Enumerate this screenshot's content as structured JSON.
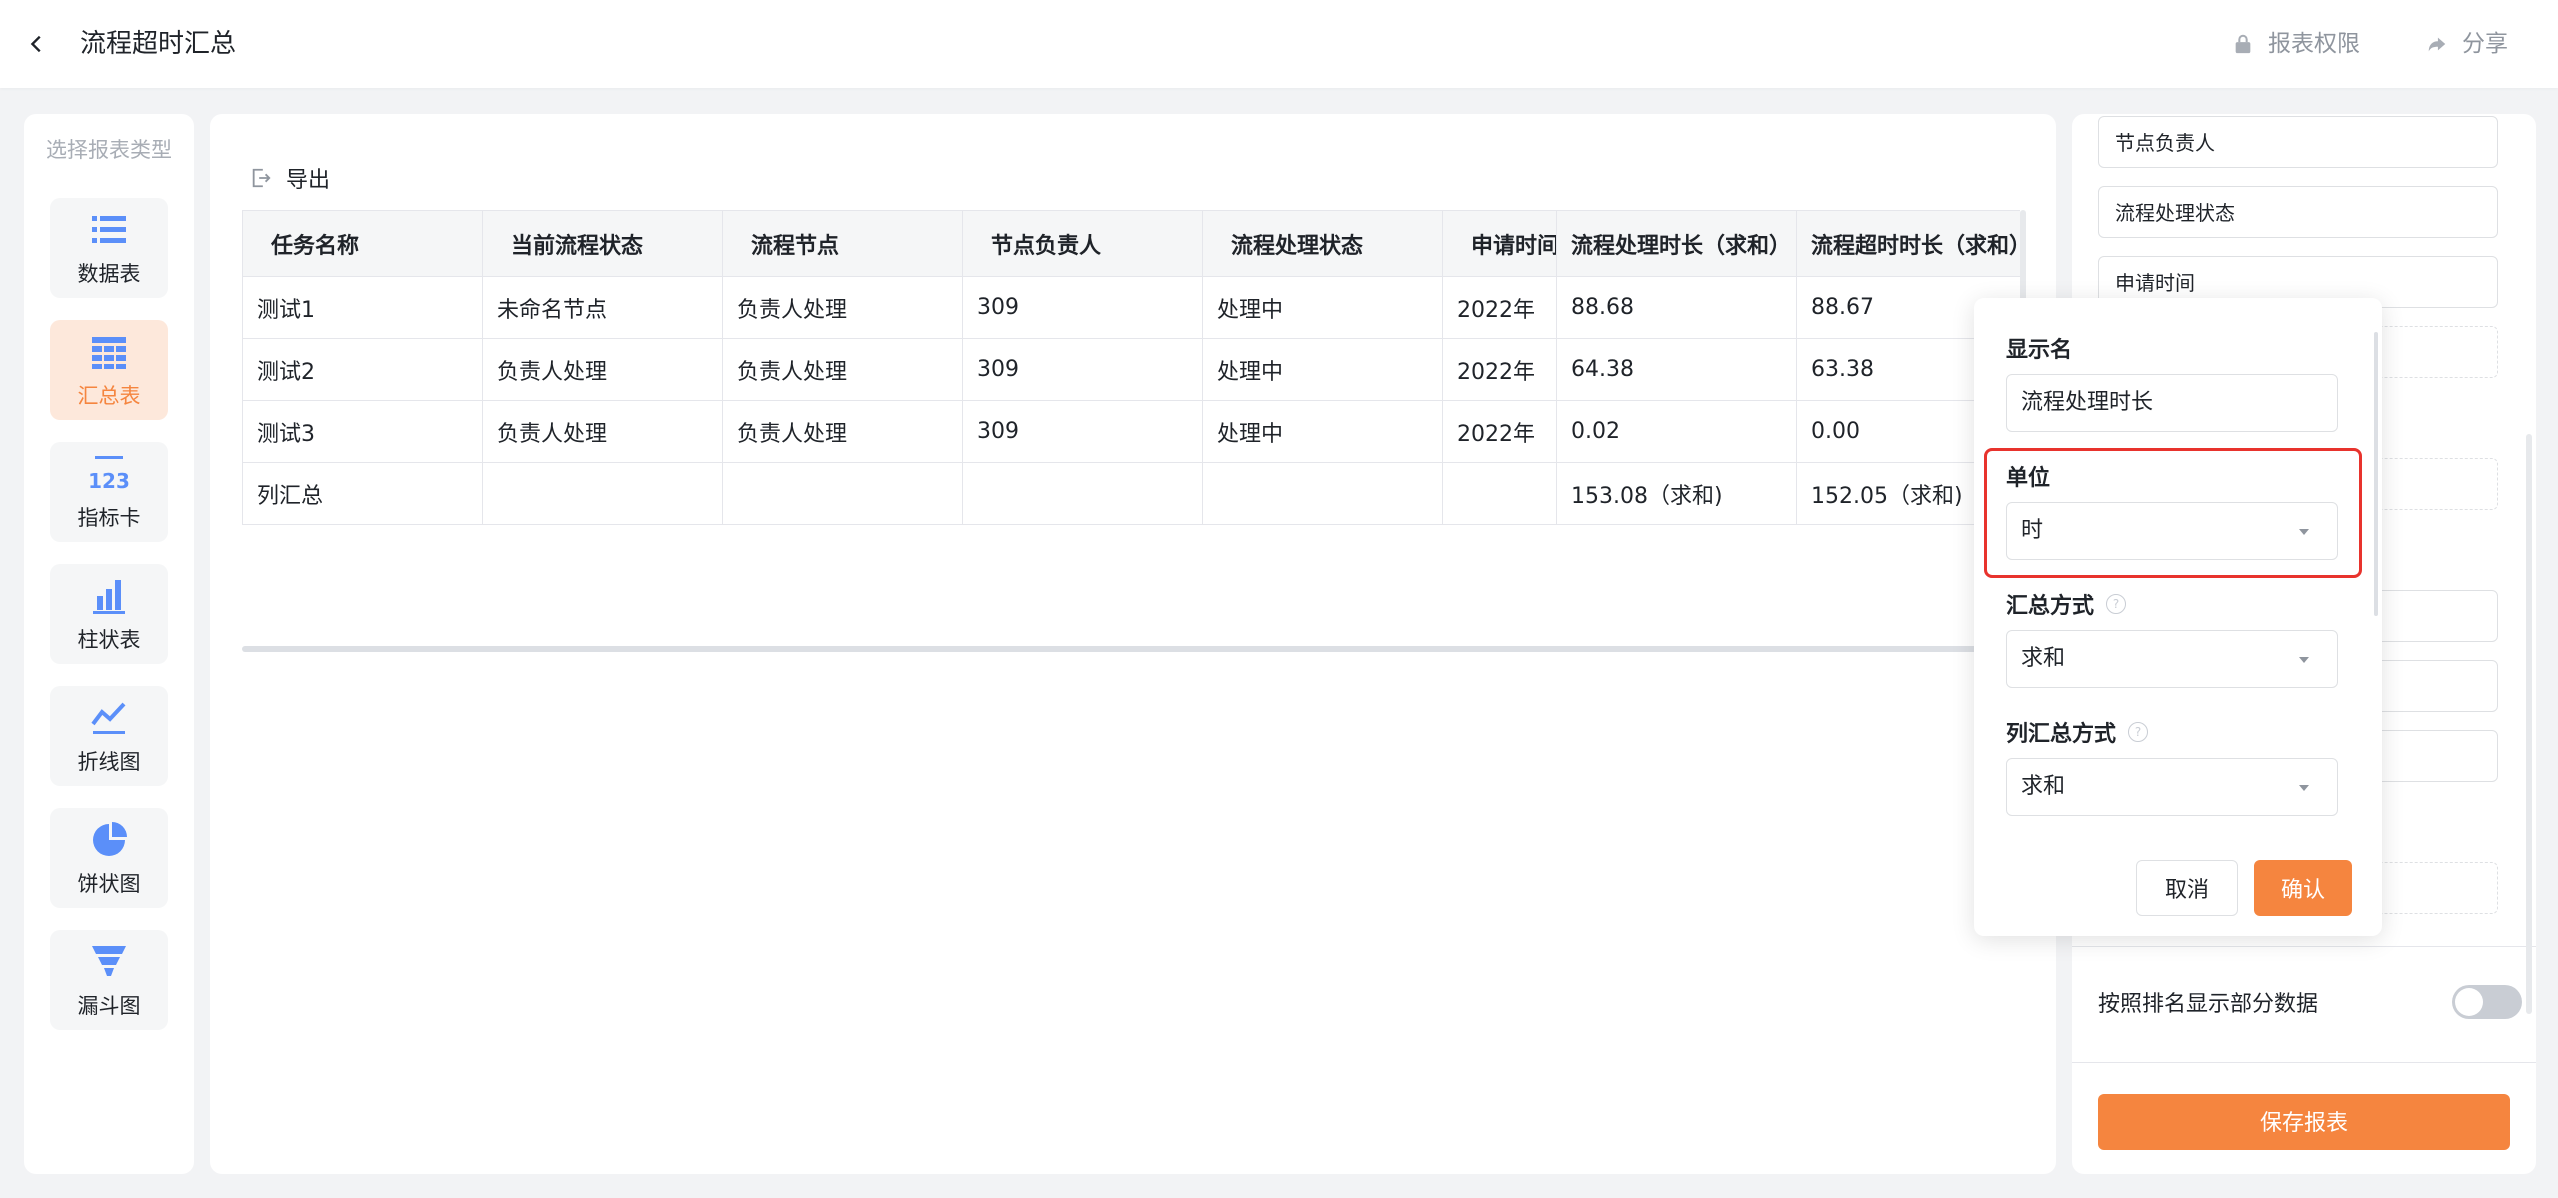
{
  "header": {
    "title": "流程超时汇总",
    "permission_label": "报表权限",
    "share_label": "分享"
  },
  "sidebar": {
    "title": "选择报表类型",
    "items": [
      {
        "label": "数据表",
        "icon": "list-icon"
      },
      {
        "label": "汇总表",
        "icon": "summary-table-icon",
        "active": true
      },
      {
        "label": "指标卡",
        "icon": "number-card-icon"
      },
      {
        "label": "柱状表",
        "icon": "bar-chart-icon"
      },
      {
        "label": "折线图",
        "icon": "line-chart-icon"
      },
      {
        "label": "饼状图",
        "icon": "pie-chart-icon"
      },
      {
        "label": "漏斗图",
        "icon": "funnel-chart-icon"
      }
    ]
  },
  "main": {
    "export_label": "导出",
    "table": {
      "headers": [
        "任务名称",
        "当前流程状态",
        "流程节点",
        "节点负责人",
        "流程处理状态",
        "申请时间",
        "流程处理时长（求和）",
        "流程超时时长（求和）"
      ],
      "rows": [
        [
          "测试1",
          "未命名节点",
          "负责人处理",
          "309",
          "处理中",
          "2022年",
          "88.68",
          "88.67"
        ],
        [
          "测试2",
          "负责人处理",
          "负责人处理",
          "309",
          "处理中",
          "2022年",
          "64.38",
          "63.38"
        ],
        [
          "测试3",
          "负责人处理",
          "负责人处理",
          "309",
          "处理中",
          "2022年",
          "0.02",
          "0.00"
        ],
        [
          "列汇总",
          "",
          "",
          "",
          "",
          "",
          "153.08（求和)",
          "152.05（求和)"
        ]
      ]
    }
  },
  "right_panel": {
    "fields": [
      "节点负责人",
      "流程处理状态",
      "申请时间"
    ],
    "toggle_label": "按照排名显示部分数据",
    "save_label": "保存报表"
  },
  "popover": {
    "display_name_label": "显示名",
    "display_name_value": "流程处理时长",
    "unit_label": "单位",
    "unit_value": "时",
    "summary_label": "汇总方式",
    "summary_value": "求和",
    "column_summary_label": "列汇总方式",
    "column_summary_value": "求和",
    "cancel_label": "取消",
    "confirm_label": "确认"
  },
  "colors": {
    "accent": "#f5853f",
    "highlight": "#e8332d",
    "icon_blue": "#5b8ff9"
  }
}
